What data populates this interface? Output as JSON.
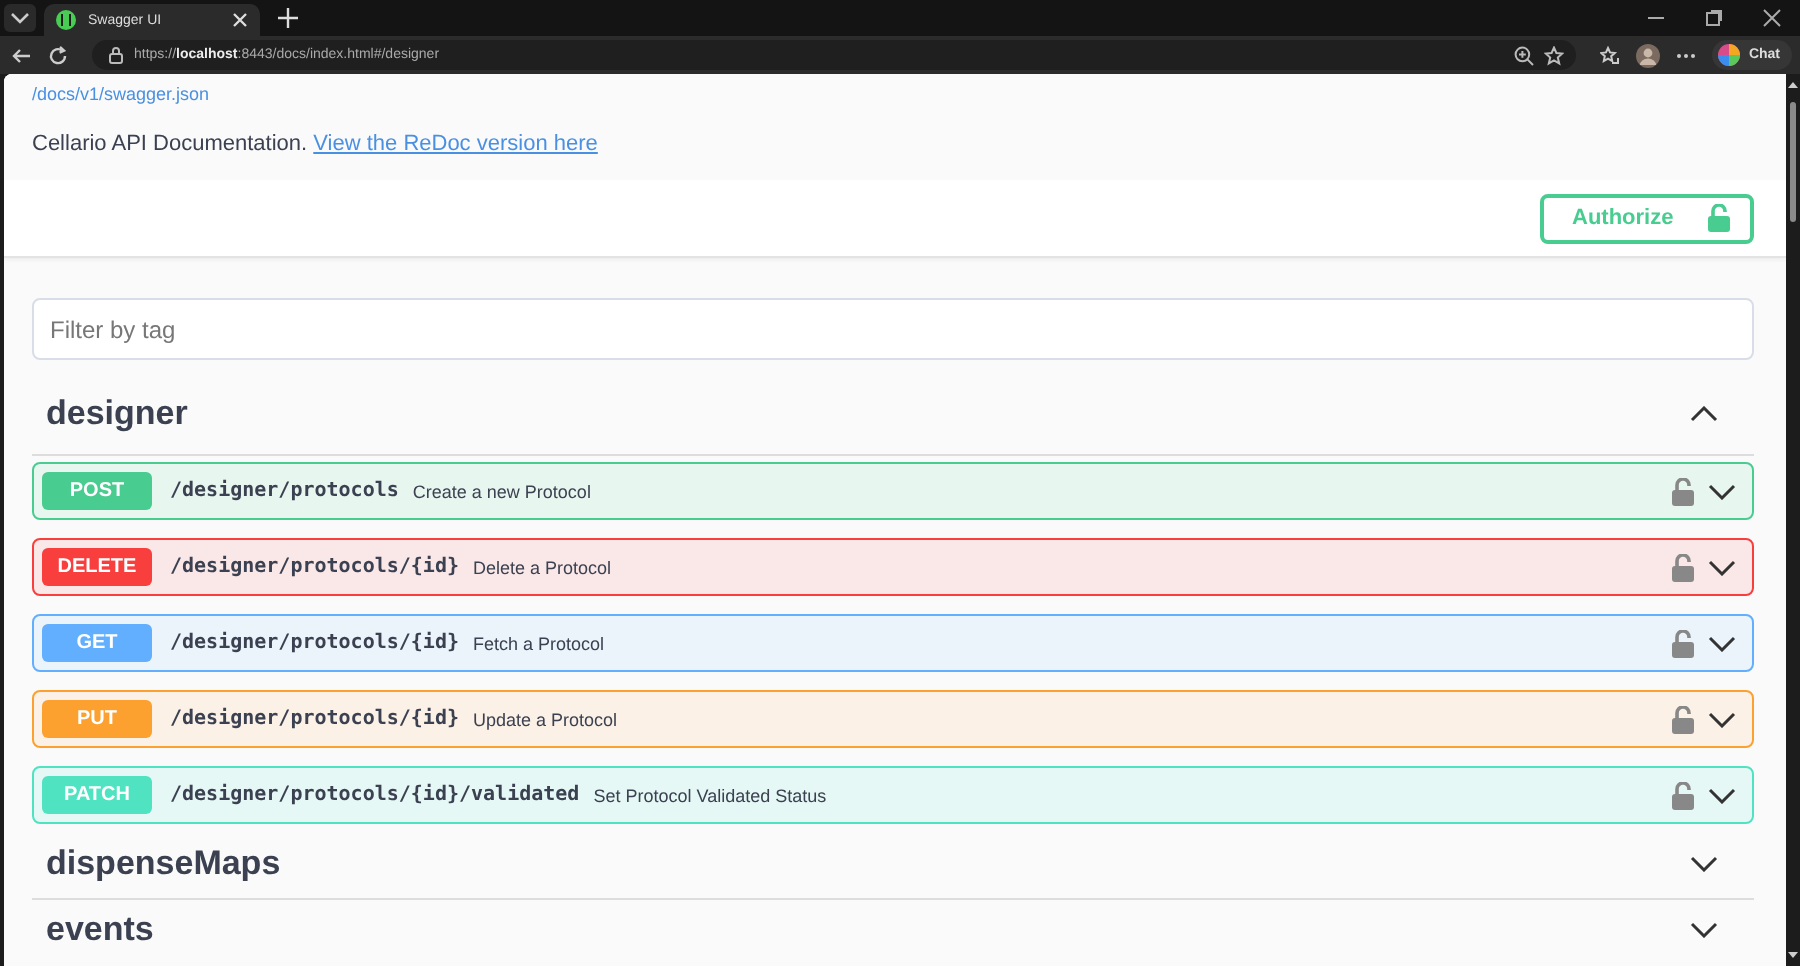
{
  "browser": {
    "tab_title": "Swagger UI",
    "url": "https://**localhost**:8443/docs/index.html#/designer",
    "chat_label": "Chat"
  },
  "info": {
    "spec_link": "/docs/v1/swagger.json",
    "description": "Cellario API Documentation.",
    "redoc_link": "View the ReDoc version here"
  },
  "authorize": {
    "label": "Authorize"
  },
  "filter": {
    "placeholder": "Filter by tag"
  },
  "tags": [
    {
      "name": "designer",
      "expanded": true,
      "operations": [
        {
          "method": "POST",
          "path": "/designer/protocols",
          "summary": "Create a new Protocol"
        },
        {
          "method": "DELETE",
          "path": "/designer/protocols/{id}",
          "summary": "Delete a Protocol"
        },
        {
          "method": "GET",
          "path": "/designer/protocols/{id}",
          "summary": "Fetch a Protocol"
        },
        {
          "method": "PUT",
          "path": "/designer/protocols/{id}",
          "summary": "Update a Protocol"
        },
        {
          "method": "PATCH",
          "path": "/designer/protocols/{id}/validated",
          "summary": "Set Protocol Validated Status"
        }
      ]
    },
    {
      "name": "dispenseMaps",
      "expanded": false
    },
    {
      "name": "events",
      "expanded": false
    }
  ]
}
